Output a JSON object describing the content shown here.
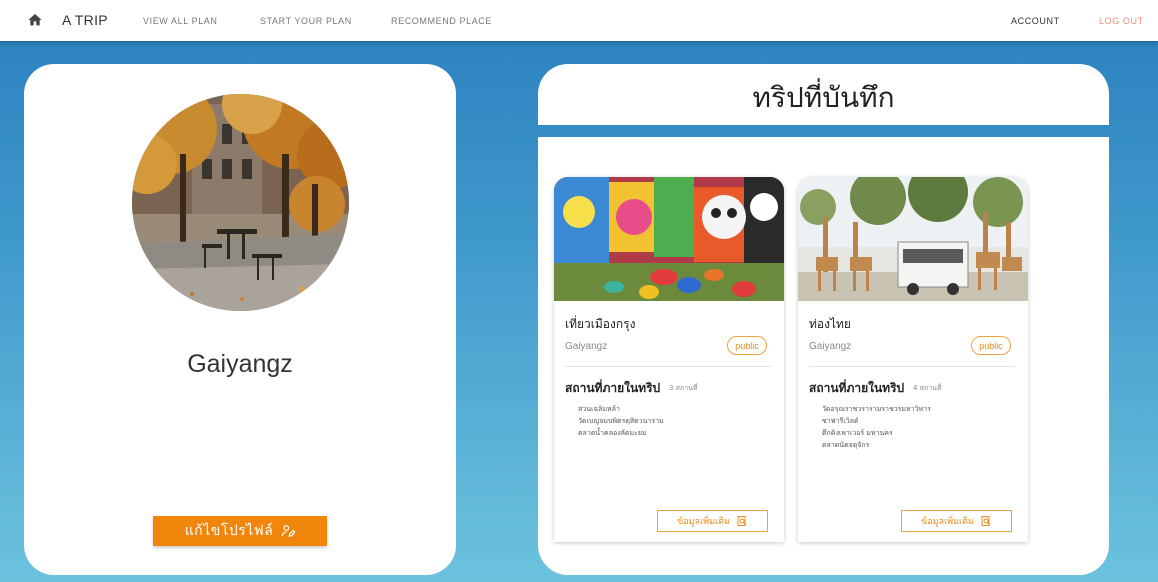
{
  "nav": {
    "brand": "A TRIP",
    "links": [
      "VIEW ALL PLAN",
      "START YOUR PLAN",
      "RECOMMEND PLACE"
    ],
    "account": "ACCOUNT",
    "logout": "LOG OUT",
    "home_icon": "home-icon"
  },
  "profile": {
    "name": "Gaiyangz",
    "edit_label": "แก้ไขโปรไฟล์"
  },
  "trips": {
    "heading": "ทริปที่บันทึก",
    "cards": [
      {
        "title": "เที่ยวเมืองกรุง",
        "owner": "Gaiyangz",
        "visibility": "public",
        "places_heading": "สถานที่ภายในทริป",
        "places_count": "3 สถานที่",
        "places": [
          "สวนเฉลิมหล้า",
          "วัดเบญจมบพิตรดุสิตวนาราม",
          "ตลาดน้ำคลองลัดมะยม"
        ],
        "more_label": "ข้อมูลเพิ่มเติม"
      },
      {
        "title": "ท่องไทย",
        "owner": "Gaiyangz",
        "visibility": "public",
        "places_heading": "สถานที่ภายในทริป",
        "places_count": "4 สถานที่",
        "places": [
          "วัดอรุณราชวรารามราชวรมหาวิหาร",
          "ซาฟารีเวิลด์",
          "ตึกคิงเพาเวอร์ มหานคร",
          "ตลาดนัดจตุจักร"
        ],
        "more_label": "ข้อมูลเพิ่มเติม"
      }
    ]
  },
  "colors": {
    "accent": "#f0870c",
    "logout": "#f18a7a",
    "background_top": "#2a7fbd",
    "background_bottom": "#6cc3de"
  }
}
